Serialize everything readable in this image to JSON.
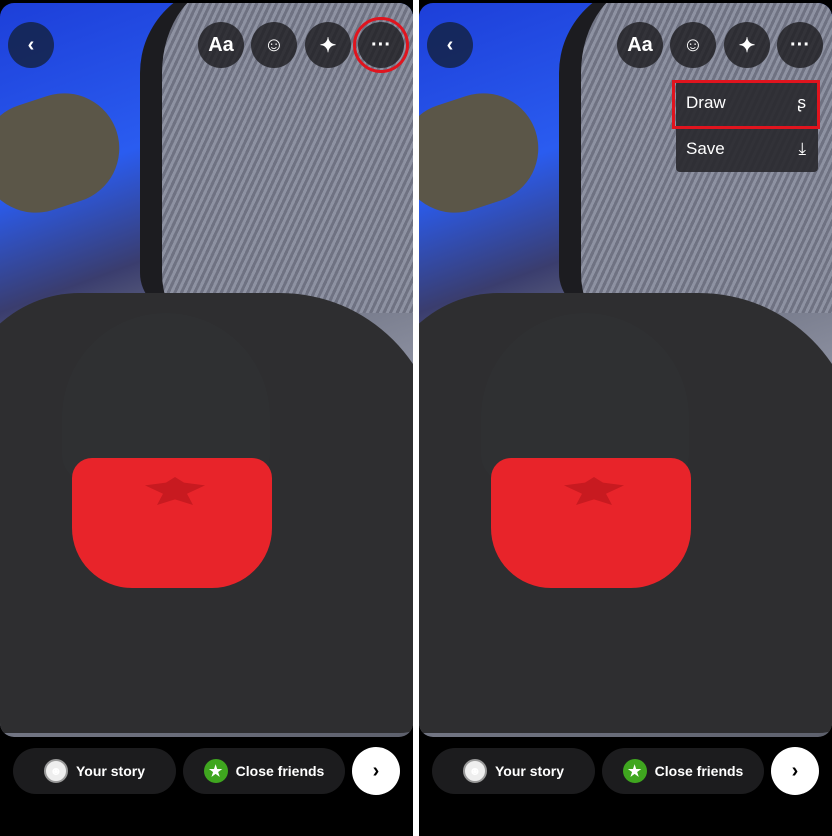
{
  "toolbar": {
    "back_icon": "‹",
    "text_label": "Aa",
    "sticker_icon": "☺",
    "effects_icon": "✦",
    "more_icon": "···"
  },
  "menu": {
    "items": [
      {
        "label": "Draw",
        "icon": "squiggle-icon",
        "glyph": "ʂ"
      },
      {
        "label": "Save",
        "icon": "download-icon",
        "glyph": "⤓"
      }
    ]
  },
  "bottom": {
    "your_story": "Your story",
    "close_friends": "Close friends",
    "next_icon": "›",
    "avatar_glyph": "☻",
    "star_glyph": "★"
  },
  "colors": {
    "highlight": "#e0141e",
    "close_friends": "#3fa61f"
  }
}
